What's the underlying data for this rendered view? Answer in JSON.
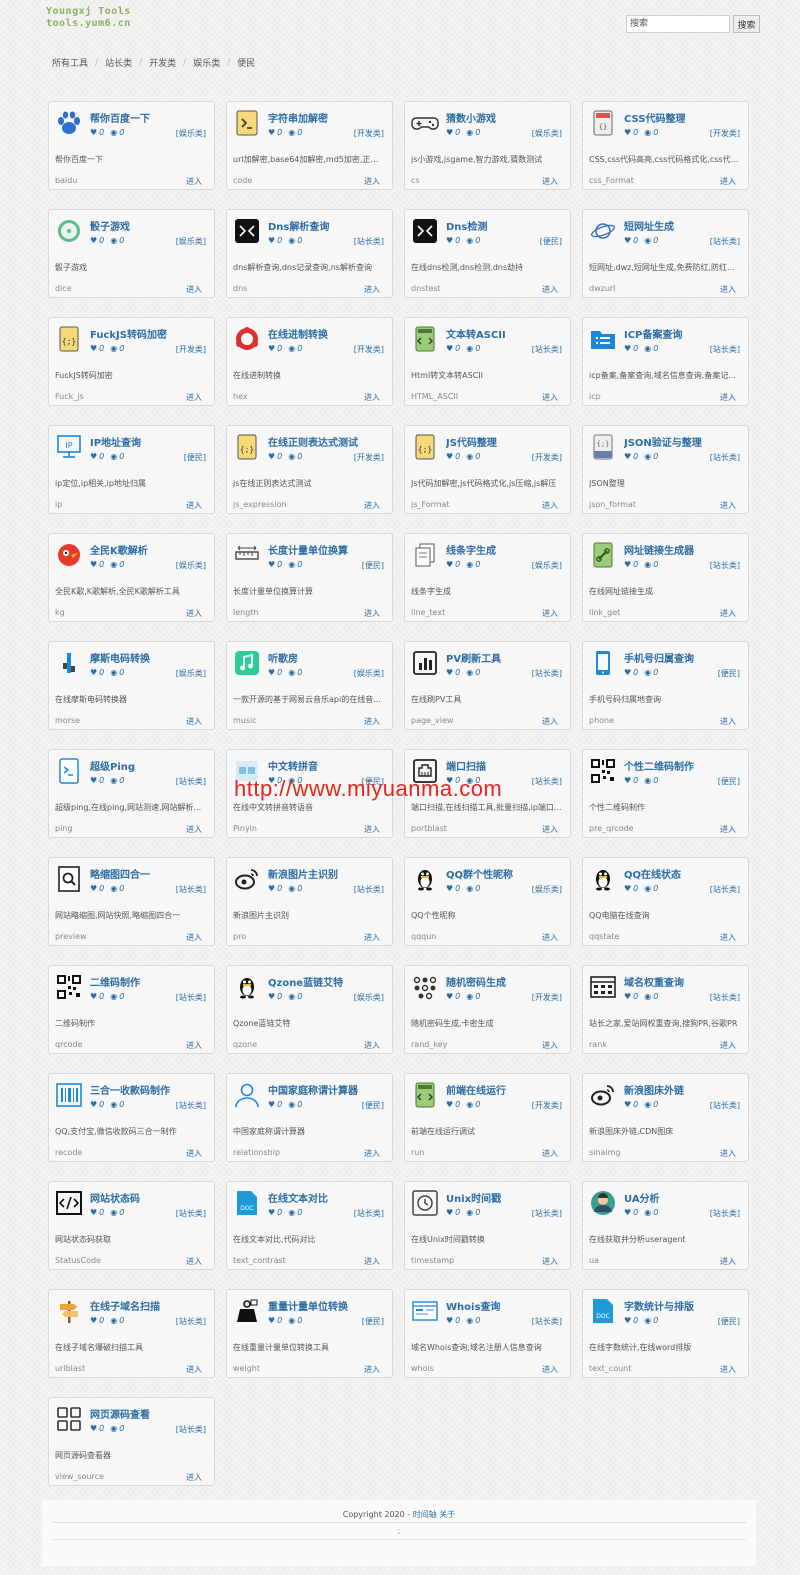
{
  "header": {
    "logo_line1": "Youngxj Tools",
    "logo_line2": "tools.yum6.cn",
    "search_placeholder": "搜索",
    "search_button": "搜索"
  },
  "breadcrumb": [
    "所有工具",
    "站长类",
    "开发类",
    "娱乐类",
    "便民"
  ],
  "watermark": "http://www.miyuanma.com",
  "card_common": {
    "likes": "0",
    "views": "0",
    "enter_label": "进入"
  },
  "colors": {
    "accent": "#2e6da4",
    "watermark": "#e8241c",
    "logo": "#8bb25e"
  },
  "tools": [
    {
      "title": "帮你百度一下",
      "cat": "[娱乐类]",
      "desc": "帮你百度一下",
      "slug": "baidu",
      "icon": "paw-icon"
    },
    {
      "title": "字符串加解密",
      "cat": "[开发类]",
      "desc": "url加解密,base64加解密,md5加密,正则...",
      "slug": "code",
      "icon": "terminal-icon"
    },
    {
      "title": "猜数小游戏",
      "cat": "[娱乐类]",
      "desc": "js小游戏,jsgame,智力游戏,猜数测试",
      "slug": "cs",
      "icon": "gamepad-icon"
    },
    {
      "title": "CSS代码整理",
      "cat": "[开发类]",
      "desc": "CSS,css代码高亮,css代码格式化,css代码...",
      "slug": "css_Format",
      "icon": "css-file-icon"
    },
    {
      "title": "骰子游戏",
      "cat": "[娱乐类]",
      "desc": "骰子游戏",
      "slug": "dice",
      "icon": "dice-icon"
    },
    {
      "title": "Dns解析查询",
      "cat": "[站长类]",
      "desc": "dns解析查询,dns记录查询,ns解析查询",
      "slug": "dns",
      "icon": "dns-icon"
    },
    {
      "title": "Dns检测",
      "cat": "[便民]",
      "desc": "在线dns检测,dns检测,dns劫持",
      "slug": "dnstest",
      "icon": "dns-icon"
    },
    {
      "title": "短网址生成",
      "cat": "[站长类]",
      "desc": "短网址,dwz,短网址生成,免费防红,防红接...",
      "slug": "dwzurl",
      "icon": "planet-icon"
    },
    {
      "title": "FuckJS转码加密",
      "cat": "[开发类]",
      "desc": "FuckJS转码加密",
      "slug": "Fuck_js",
      "icon": "js-file-icon"
    },
    {
      "title": "在线进制转换",
      "cat": "[开发类]",
      "desc": "在线进制转换",
      "slug": "hex",
      "icon": "share-nodes-icon"
    },
    {
      "title": "文本转ASCII",
      "cat": "[站长类]",
      "desc": "Html转文本转ASCII",
      "slug": "HTML_ASCII",
      "icon": "html-file-icon"
    },
    {
      "title": "ICP备案查询",
      "cat": "[站长类]",
      "desc": "icp备案,备案查询,域名信息查询,备案记...",
      "slug": "icp",
      "icon": "folder-list-icon"
    },
    {
      "title": "IP地址查询",
      "cat": "[便民]",
      "desc": "ip定位,ip相关,ip地址归属",
      "slug": "ip",
      "icon": "monitor-ip-icon"
    },
    {
      "title": "在线正则表达式测试",
      "cat": "[开发类]",
      "desc": "js在线正则表达式测试",
      "slug": "js_expression",
      "icon": "js-file-icon"
    },
    {
      "title": "JS代码整理",
      "cat": "[开发类]",
      "desc": "Js代码加解密,js代码格式化,js压缩,js解压",
      "slug": "js_Format",
      "icon": "js-file-icon"
    },
    {
      "title": "JSON验证与整理",
      "cat": "[站长类]",
      "desc": "JSON整理",
      "slug": "json_format",
      "icon": "json-file-icon"
    },
    {
      "title": "全民K歌解析",
      "cat": "[娱乐类]",
      "desc": "全民K歌,K歌解析,全民K歌解析工具",
      "slug": "kg",
      "icon": "bird-icon"
    },
    {
      "title": "长度计量单位换算",
      "cat": "[便民]",
      "desc": "长度计量单位换算计算",
      "slug": "length",
      "icon": "ruler-icon"
    },
    {
      "title": "线条字生成",
      "cat": "[娱乐类]",
      "desc": "线条字生成",
      "slug": "line_text",
      "icon": "copy-files-icon"
    },
    {
      "title": "网址链接生成器",
      "cat": "[站长类]",
      "desc": "在线网址链接生成",
      "slug": "link_get",
      "icon": "link-file-icon"
    },
    {
      "title": "摩斯电码转换",
      "cat": "[娱乐类]",
      "desc": "在线摩斯电码转换器",
      "slug": "morse",
      "icon": "morse-icon"
    },
    {
      "title": "听歌房",
      "cat": "[娱乐类]",
      "desc": "一款开源的基于网易云音乐api的在线音...",
      "slug": "music",
      "icon": "music-note-icon"
    },
    {
      "title": "PV刷新工具",
      "cat": "[站长类]",
      "desc": "在线刷PV工具",
      "slug": "page_view",
      "icon": "bar-chart-icon"
    },
    {
      "title": "手机号归属查询",
      "cat": "[便民]",
      "desc": "手机号码归属地查询",
      "slug": "phone",
      "icon": "phone-icon"
    },
    {
      "title": "超级Ping",
      "cat": "[站长类]",
      "desc": "超级ping,在线ping,网站测速,网站解析...",
      "slug": "ping",
      "icon": "terminal-file-icon"
    },
    {
      "title": "中文转拼音",
      "cat": "[便民]",
      "desc": "在线中文转拼音转语音",
      "slug": "Pinyin",
      "icon": "pinyin-icon"
    },
    {
      "title": "端口扫描",
      "cat": "[站长类]",
      "desc": "端口扫描,在线扫描工具,批量扫描,ip端口...",
      "slug": "portblast",
      "icon": "network-port-icon"
    },
    {
      "title": "个性二维码制作",
      "cat": "[便民]",
      "desc": "个性二维码制作",
      "slug": "pre_qrcode",
      "icon": "qrcode-icon"
    },
    {
      "title": "略缩图四合一",
      "cat": "[站长类]",
      "desc": "网站略缩图,网站快照,略缩图四合一",
      "slug": "preview",
      "icon": "search-file-icon"
    },
    {
      "title": "新浪图片主识别",
      "cat": "[站长类]",
      "desc": "新浪图片主识别",
      "slug": "pro",
      "icon": "weibo-icon"
    },
    {
      "title": "QQ群个性昵称",
      "cat": "[娱乐类]",
      "desc": "QQ个性昵称",
      "slug": "qqqun",
      "icon": "qq-penguin-icon"
    },
    {
      "title": "QQ在线状态",
      "cat": "[站长类]",
      "desc": "QQ电脑在线查询",
      "slug": "qqstate",
      "icon": "qq-penguin-icon"
    },
    {
      "title": "二维码制作",
      "cat": "[站长类]",
      "desc": "二维码制作",
      "slug": "qrcode",
      "icon": "qrcode-icon"
    },
    {
      "title": "Qzone蓝链艾特",
      "cat": "[娱乐类]",
      "desc": "Qzone蓝链艾特",
      "slug": "qzone",
      "icon": "qq-penguin-icon"
    },
    {
      "title": "随机密码生成",
      "cat": "[开发类]",
      "desc": "随机密码生成,卡密生成",
      "slug": "rand_key",
      "icon": "dots-grid-icon"
    },
    {
      "title": "域名权重查询",
      "cat": "[站长类]",
      "desc": "站长之家,爱站网权重查询,搜狗PR,谷歌PR",
      "slug": "rank",
      "icon": "browser-grid-icon"
    },
    {
      "title": "三合一收款码制作",
      "cat": "[站长类]",
      "desc": "QQ,支付宝,微信收款码三合一制作",
      "slug": "recode",
      "icon": "barcode-icon"
    },
    {
      "title": "中国家庭称谓计算器",
      "cat": "[便民]",
      "desc": "中国家庭称谓计算器",
      "slug": "relationship",
      "icon": "user-outline-icon"
    },
    {
      "title": "前端在线运行",
      "cat": "[开发类]",
      "desc": "前端在线运行调试",
      "slug": "run",
      "icon": "html-file-icon"
    },
    {
      "title": "新浪图床外链",
      "cat": "[站长类]",
      "desc": "新浪图床外链,CDN图床",
      "slug": "sinaimg",
      "icon": "weibo-icon"
    },
    {
      "title": "网站状态码",
      "cat": "[站长类]",
      "desc": "网站状态码获取",
      "slug": "StatusCode",
      "icon": "code-window-icon"
    },
    {
      "title": "在线文本对比",
      "cat": "[站长类]",
      "desc": "在线文本对比,代码对比",
      "slug": "text_contrast",
      "icon": "doc-file-icon"
    },
    {
      "title": "Unix时间戳",
      "cat": "[站长类]",
      "desc": "在线Unix时间戳转换",
      "slug": "timestamp",
      "icon": "clock-box-icon"
    },
    {
      "title": "UA分析",
      "cat": "[站长类]",
      "desc": "在线获取并分析useragent",
      "slug": "ua",
      "icon": "user-avatar-icon"
    },
    {
      "title": "在线子域名扫描",
      "cat": "[站长类]",
      "desc": "在线子域名爆破扫描工具",
      "slug": "urlblast",
      "icon": "signpost-icon"
    },
    {
      "title": "重量计量单位转换",
      "cat": "[便民]",
      "desc": "在线重量计量单位转换工具",
      "slug": "weight",
      "icon": "weight-icon"
    },
    {
      "title": "Whois查询",
      "cat": "[站长类]",
      "desc": "域名Whois查询,域名注册人信息查询",
      "slug": "whois",
      "icon": "id-card-icon"
    },
    {
      "title": "字数统计与排版",
      "cat": "[便民]",
      "desc": "在线字数统计,在线word排版",
      "slug": "text_count",
      "icon": "doc-file-icon"
    },
    {
      "title": "网页源码查看",
      "cat": "[站长类]",
      "desc": "网页源码查看器",
      "slug": "view_source",
      "icon": "four-squares-icon"
    }
  ],
  "footer": {
    "copyright": "Copyright 2020 -",
    "link1": "时间轴",
    "link2": "关于",
    "mark": ";"
  }
}
